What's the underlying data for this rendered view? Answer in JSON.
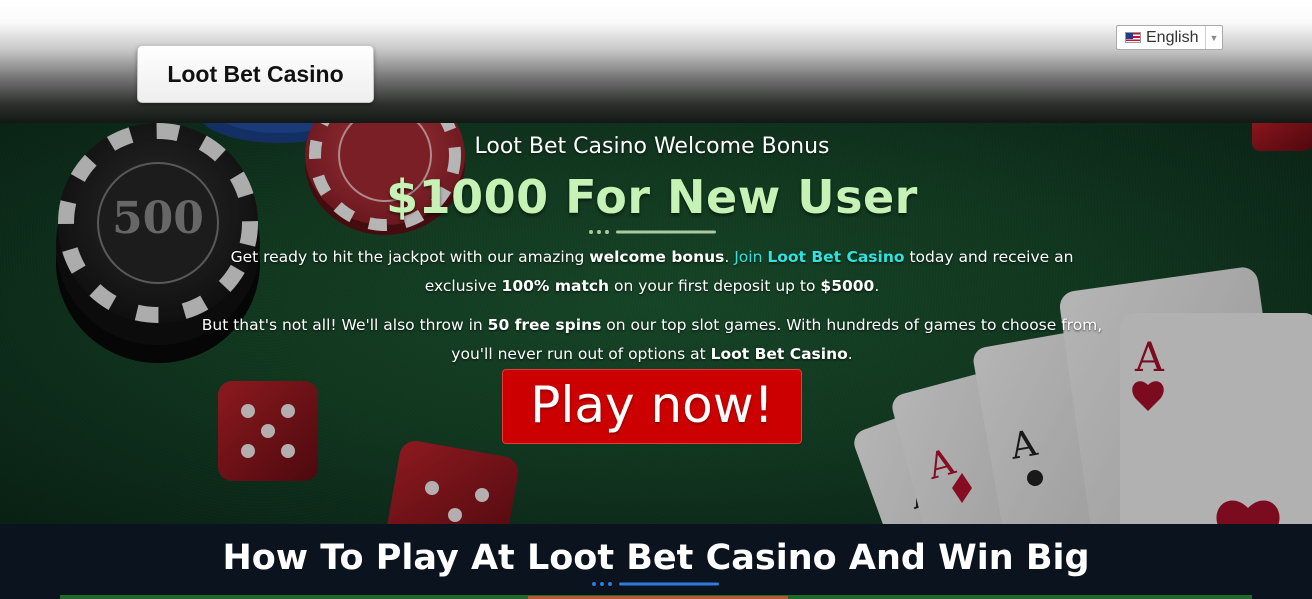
{
  "header": {
    "logo_label": "Loot Bet Casino",
    "language": {
      "selected": "English",
      "flag_icon": "us-flag-icon"
    }
  },
  "hero": {
    "subtitle": "Loot Bet Casino Welcome Bonus",
    "title": "$1000 For New User",
    "paragraph1": {
      "t1": "Get ready to hit the jackpot with our amazing ",
      "b1": "welcome bonus",
      "t2": ". ",
      "link_prefix": "Join ",
      "link_name": "Loot Bet Casino",
      "t3": " today and receive an exclusive ",
      "b2": "100% match",
      "t4": " on your first deposit up to ",
      "b3": "$5000",
      "t5": "."
    },
    "paragraph2": {
      "t1": "But that's not all! We'll also throw in ",
      "b1": "50 free spins",
      "t2": " on our top slot games. With hundreds of games to choose from, you'll never run out of options at ",
      "b2": "Loot Bet Casino",
      "t3": "."
    },
    "cta_label": "Play now!",
    "chip_value": "500"
  },
  "how_section": {
    "title": "How To Play At Loot Bet Casino And Win Big"
  },
  "colors": {
    "felt_green": "#174a2a",
    "title_green": "#c6f2b5",
    "link_cyan": "#2fe3e0",
    "cta_red": "#cc0000",
    "accent_blue": "#2f7be0",
    "dark_navy": "#0b131e"
  }
}
